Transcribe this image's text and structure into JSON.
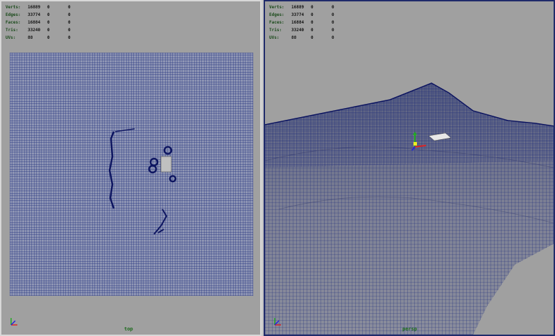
{
  "left_viewport": {
    "hud": [
      {
        "label": "Verts:",
        "count": "16889",
        "sel": "0",
        "sel2": "0"
      },
      {
        "label": "Edges:",
        "count": "33774",
        "sel": "0",
        "sel2": "0"
      },
      {
        "label": "Faces:",
        "count": "16884",
        "sel": "0",
        "sel2": "0"
      },
      {
        "label": "Tris:",
        "count": "33240",
        "sel": "0",
        "sel2": "0"
      },
      {
        "label": "UVs:",
        "count": "88",
        "sel": "0",
        "sel2": "0"
      }
    ],
    "camera": "top"
  },
  "right_viewport": {
    "hud": [
      {
        "label": "Verts:",
        "count": "16889",
        "sel": "0",
        "sel2": "0"
      },
      {
        "label": "Edges:",
        "count": "33774",
        "sel": "0",
        "sel2": "0"
      },
      {
        "label": "Faces:",
        "count": "16884",
        "sel": "0",
        "sel2": "0"
      },
      {
        "label": "Tris:",
        "count": "33240",
        "sel": "0",
        "sel2": "0"
      },
      {
        "label": "UVs:",
        "count": "88",
        "sel": "0",
        "sel2": "0"
      }
    ],
    "camera": "persp"
  },
  "colors": {
    "wire": "#1c2a7a",
    "active_border": "#1f2a6a",
    "viewport_bg": "#a0a0a0"
  },
  "icons": {
    "axis": "xyz-axis-icon",
    "manipulator": "move-manipulator-icon"
  }
}
